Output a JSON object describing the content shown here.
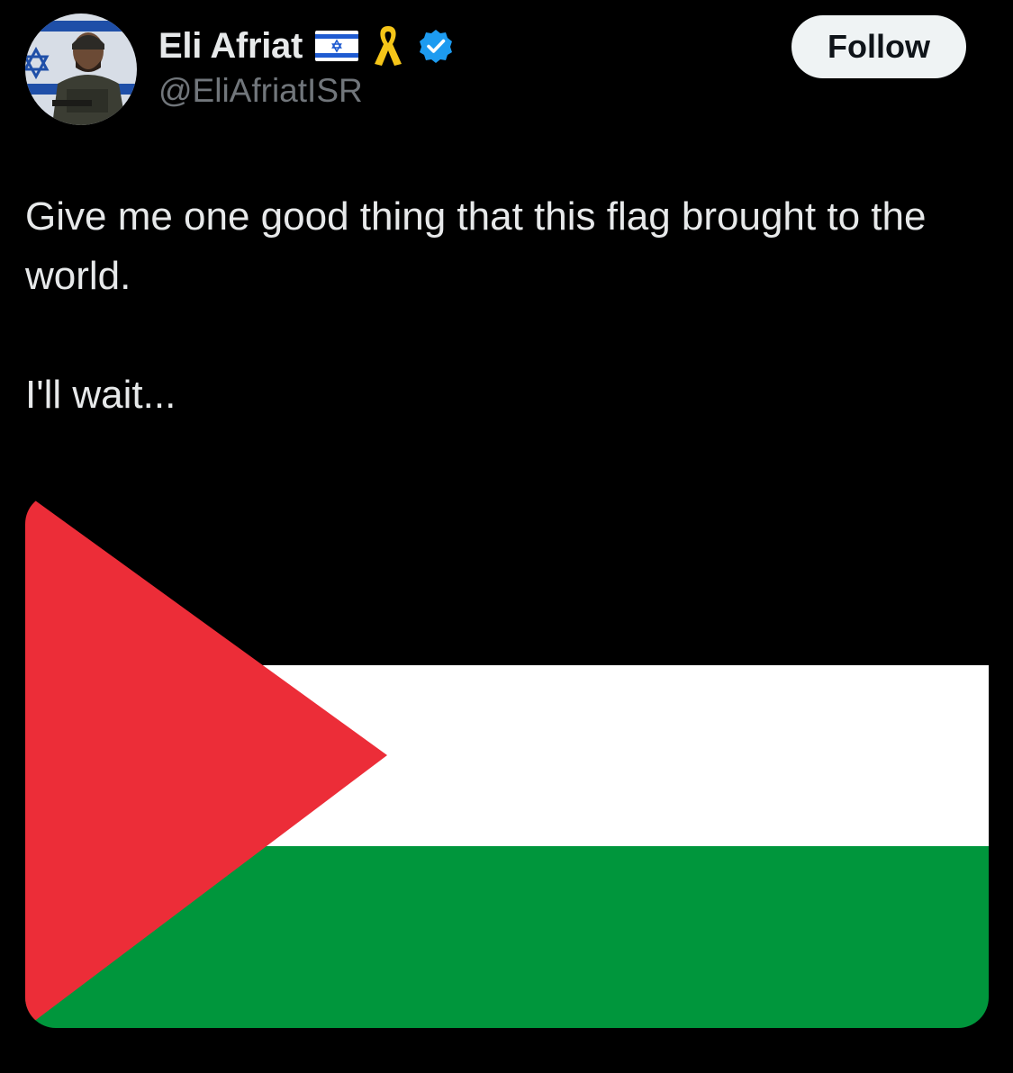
{
  "tweet": {
    "author": {
      "display_name": "Eli Afriat",
      "handle": "@EliAfriatISR",
      "name_badges": [
        "israel-flag-icon",
        "yellow-ribbon-icon",
        "verified-badge-icon"
      ]
    },
    "follow_label": "Follow",
    "text_lines": [
      "Give me one good thing that this flag brought to the world.",
      "I'll wait..."
    ],
    "media": {
      "image": "palestinian-flag",
      "colors": {
        "triangle": "#ec2d38",
        "top_band": "#000000",
        "middle_band": "#ffffff",
        "bottom_band": "#00963c"
      }
    }
  },
  "colors": {
    "background": "#000000",
    "primary_text": "#e7e9ea",
    "secondary_text": "#71767b",
    "verified": "#1d9bf0",
    "follow_button_bg": "#eff3f4",
    "follow_button_text": "#0f1419"
  }
}
